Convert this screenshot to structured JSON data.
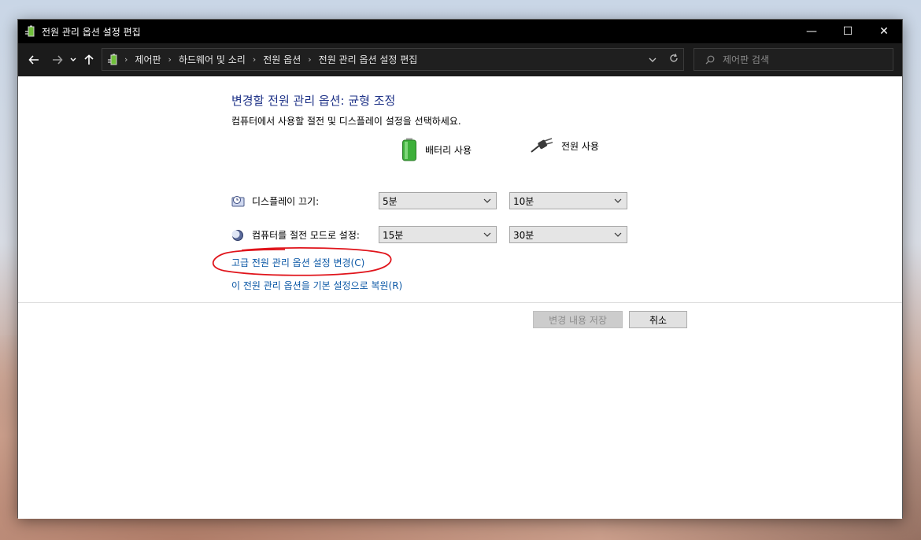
{
  "window": {
    "title": "전원 관리 옵션 설정 편집",
    "controls": {
      "minimize": "—",
      "maximize": "☐",
      "close": "✕"
    }
  },
  "address_bar": {
    "breadcrumbs": [
      "제어판",
      "하드웨어 및 소리",
      "전원 옵션",
      "전원 관리 옵션 설정 편집"
    ],
    "search_placeholder": "제어판 검색"
  },
  "main": {
    "heading": "변경할 전원 관리 옵션: 균형 조정",
    "description": "컴퓨터에서 사용할 절전 및 디스플레이 설정을 선택하세요.",
    "columns": {
      "battery": "배터리 사용",
      "plugged": "전원 사용"
    },
    "rows": [
      {
        "label": "디스플레이 끄기:",
        "battery_value": "5분",
        "plugged_value": "10분"
      },
      {
        "label": "컴퓨터를 절전 모드로 설정:",
        "battery_value": "15분",
        "plugged_value": "30분"
      }
    ],
    "links": {
      "advanced": "고급 전원 관리 옵션 설정 변경(C)",
      "restore": "이 전원 관리 옵션을 기본 설정으로 복원(R)"
    },
    "buttons": {
      "save": "변경 내용 저장",
      "cancel": "취소"
    }
  },
  "colors": {
    "heading": "#1e3287",
    "link": "#0b57a5",
    "annotation": "#e0141b",
    "titlebar": "#000000"
  },
  "icons": {
    "title": "power-options-icon",
    "battery": "battery-icon",
    "plug": "power-plug-icon",
    "display": "display-clock-icon",
    "sleep": "moon-icon"
  }
}
